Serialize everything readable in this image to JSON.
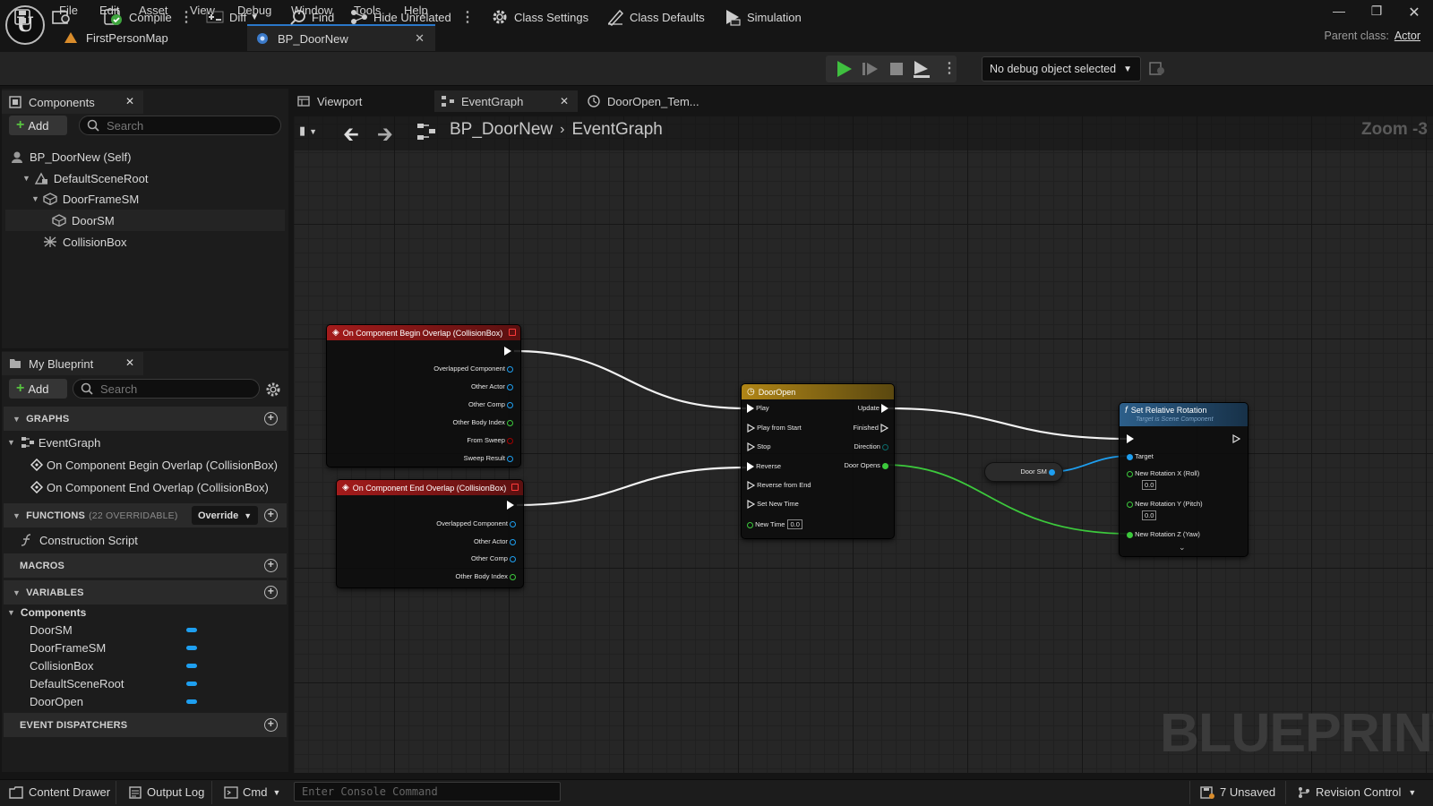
{
  "menu": [
    "File",
    "Edit",
    "Asset",
    "View",
    "Debug",
    "Window",
    "Tools",
    "Help"
  ],
  "tabs": {
    "map": "FirstPersonMap",
    "blueprint": "BP_DoorNew"
  },
  "parent_class": {
    "label": "Parent class:",
    "value": "Actor"
  },
  "toolbar": {
    "compile": "Compile",
    "diff": "Diff",
    "find": "Find",
    "hide_unrelated": "Hide Unrelated",
    "class_settings": "Class Settings",
    "class_defaults": "Class Defaults",
    "simulation": "Simulation",
    "debug_object": "No debug object selected"
  },
  "components_panel": {
    "title": "Components",
    "add": "Add",
    "search_placeholder": "Search",
    "tree": [
      "BP_DoorNew (Self)",
      "DefaultSceneRoot",
      "DoorFrameSM",
      "DoorSM",
      "CollisionBox"
    ]
  },
  "my_blueprint": {
    "title": "My Blueprint",
    "add": "Add",
    "search_placeholder": "Search",
    "graphs_label": "GRAPHS",
    "event_graph": "EventGraph",
    "events": [
      "On Component Begin Overlap (CollisionBox)",
      "On Component End Overlap (CollisionBox)"
    ],
    "functions_label": "FUNCTIONS",
    "functions_count": "(22 OVERRIDABLE)",
    "override": "Override",
    "construction_script": "Construction Script",
    "macros_label": "MACROS",
    "variables_label": "VARIABLES",
    "components_group": "Components",
    "variables": [
      "DoorSM",
      "DoorFrameSM",
      "CollisionBox",
      "DefaultSceneRoot",
      "DoorOpen"
    ],
    "event_dispatchers_label": "EVENT DISPATCHERS"
  },
  "graph_tabs": [
    "Viewport",
    "EventGraph",
    "DoorOpen_Tem..."
  ],
  "breadcrumb": {
    "root": "BP_DoorNew",
    "current": "EventGraph"
  },
  "zoom": "Zoom -3",
  "watermark": "BLUEPRINT",
  "nodes": {
    "begin_overlap": {
      "title": "On Component Begin Overlap (CollisionBox)",
      "pins": [
        "Overlapped Component",
        "Other Actor",
        "Other Comp",
        "Other Body Index",
        "From Sweep",
        "Sweep Result"
      ]
    },
    "end_overlap": {
      "title": "On Component End Overlap (CollisionBox)",
      "pins": [
        "Overlapped Component",
        "Other Actor",
        "Other Comp",
        "Other Body Index"
      ]
    },
    "door_open": {
      "title": "DoorOpen",
      "inputs": [
        "Play",
        "Play from Start",
        "Stop",
        "Reverse",
        "Reverse from End",
        "Set New Time",
        "New Time"
      ],
      "new_time_value": "0.0",
      "outputs": [
        "Update",
        "Finished",
        "Direction",
        "Door Opens"
      ]
    },
    "door_sm_ref": {
      "title": "Door SM"
    },
    "set_rotation": {
      "title": "Set Relative Rotation",
      "subtitle": "Target is Scene Component",
      "pins": [
        "Target",
        "New Rotation X (Roll)",
        "New Rotation Y (Pitch)",
        "New Rotation Z (Yaw)"
      ],
      "x_value": "0.0",
      "y_value": "0.0"
    }
  },
  "bottom": {
    "content_drawer": "Content Drawer",
    "output_log": "Output Log",
    "cmd": "Cmd",
    "console_placeholder": "Enter Console Command",
    "unsaved": "7 Unsaved",
    "revision_control": "Revision Control"
  }
}
